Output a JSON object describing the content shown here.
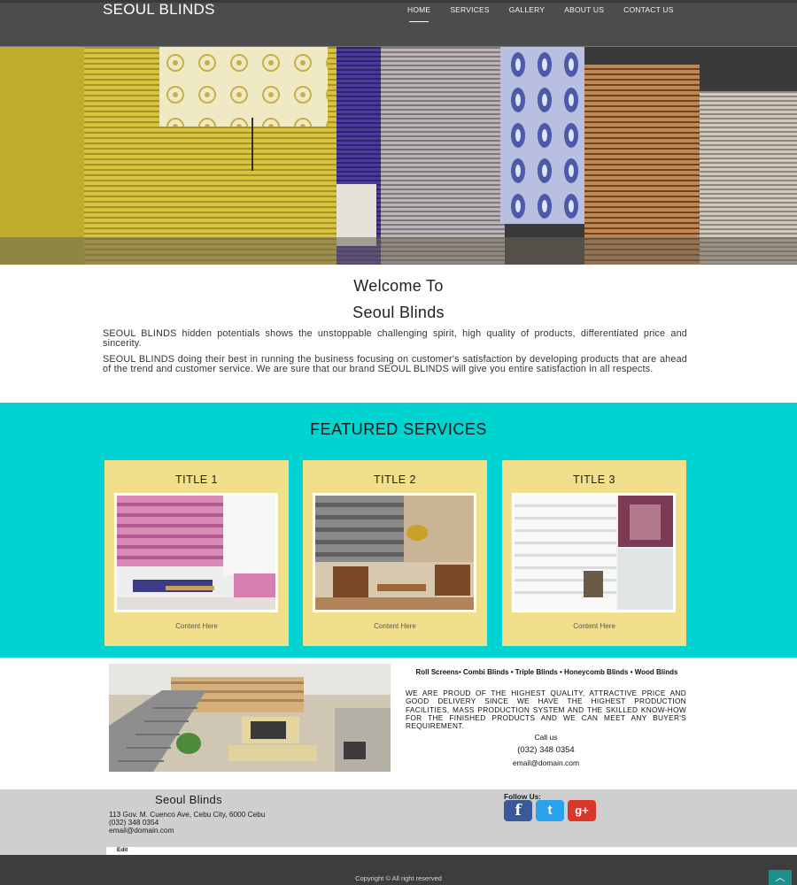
{
  "header": {
    "brand": "SEOUL BLINDS",
    "nav": [
      "HOME",
      "SERVICES",
      "GALLERY",
      "ABOUT US",
      "CONTACT US"
    ]
  },
  "welcome": {
    "title_line1": "Welcome To",
    "title_line2": "Seoul Blinds",
    "para1": "SEOUL BLINDS hidden potentials shows the unstoppable challenging spirit, high quality of products, differentiated price and sincerity.",
    "para2": "SEOUL BLINDS doing their best in running the business focusing on customer's satisfaction by developing products that are ahead of the trend and customer service. We are sure that our brand SEOUL BLINDS will give you entire satisfaction in all respects."
  },
  "featured": {
    "heading": "FEATURED SERVICES",
    "cards": [
      {
        "title": "TITLE 1",
        "content": "Content Here"
      },
      {
        "title": "TITLE 2",
        "content": "Content Here"
      },
      {
        "title": "TITLE 3",
        "content": "Content Here"
      }
    ]
  },
  "promo": {
    "types": "Roll Screens• Combi Blinds • Triple Blinds • Honeycomb Blinds • Wood Blinds",
    "statement": "WE ARE PROUD OF THE HIGHEST QUALITY, ATTRACTIVE PRICE AND GOOD DELIVERY SINCE WE HAVE THE HIGHEST PRODUCTION FACILITIES, MASS PRODUCTION SYSTEM AND THE SKILLED KNOW-HOW FOR THE FINISHED PRODUCTS AND WE CAN MEET ANY BUYER'S REQUIREMENT.",
    "call_label": "Call us",
    "phone": "(032) 348 0354",
    "email": "email@domain.com"
  },
  "footer": {
    "title": "Seoul Blinds",
    "address": "113 Gov. M. Cuenco Ave, Cebu City, 6000 Cebu",
    "phone": "(032) 348 0354",
    "email": "email@domain.com",
    "follow_label": "Follow Us:",
    "social": [
      {
        "icon": "facebook-icon",
        "glyph": "f",
        "color": "#3b5998"
      },
      {
        "icon": "twitter-icon",
        "glyph": "t",
        "color": "#2aa3ef"
      },
      {
        "icon": "google-plus-icon",
        "glyph": "g+",
        "color": "#d8382b"
      }
    ],
    "edit": "Edit",
    "copyright": "Copyright © All right reserved",
    "to_top_glyph": "︿"
  },
  "colors": {
    "header_bg": "#4c4c4c",
    "featured_bg": "#00d4d0",
    "card_bg": "#f2df8c",
    "footer_bg": "#cfcfcf",
    "bottom_bar_bg": "#3d3d3d",
    "to_top_bg": "#1d8f8a"
  }
}
